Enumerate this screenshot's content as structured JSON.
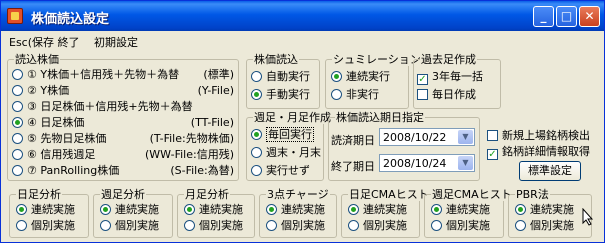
{
  "window": {
    "title": "株価読込設定"
  },
  "titlebar_buttons": {
    "minimize": "_",
    "maximize": "□",
    "close": "✕"
  },
  "menu": [
    "Esc(保存 終了",
    "初期設定"
  ],
  "stock_load": {
    "legend": "読込株価",
    "items": [
      {
        "left": "① Y株価＋信用残＋先物＋為替",
        "right": "(標準)",
        "selected": false
      },
      {
        "left": "② Y株価",
        "right": "(Y-File)",
        "selected": false
      },
      {
        "left": "③ 日足株価＋信用残+先物＋為替",
        "right": "",
        "selected": false
      },
      {
        "left": "④ 日足株価",
        "right": "(TT-File)",
        "selected": true
      },
      {
        "left": "⑤ 先物日足株価",
        "right": "(T-File:先物株価)",
        "selected": false
      },
      {
        "left": "⑥ 信用残週足",
        "right": "(WW-File:信用残)",
        "selected": false
      },
      {
        "left": "⑦ PanRolling株価",
        "right": "(S-File:為替)",
        "selected": false
      }
    ]
  },
  "price_read": {
    "legend": "株価読込",
    "options": [
      "自動実行",
      "手動実行"
    ],
    "selected": 1
  },
  "simulation": {
    "legend": "シュミレーション",
    "options": [
      "連続実行",
      "非実行"
    ],
    "selected": 0
  },
  "past_data": {
    "legend": "過去足作成",
    "options": [
      {
        "label": "3年毎一括",
        "checked": true
      },
      {
        "label": "毎日作成",
        "checked": false
      }
    ]
  },
  "weekly_monthly": {
    "legend": "週足・月足作成",
    "options": [
      "毎回実行",
      "週末・月末",
      "実行せず"
    ],
    "selected": 0
  },
  "period": {
    "legend": "株価読込期日指定",
    "read_label": "読済期日",
    "read_date": "2008/10/22",
    "end_label": "終了期日",
    "end_date": "2008/10/24"
  },
  "checkboxes": [
    {
      "label": "新規上場銘柄検出",
      "checked": false
    },
    {
      "label": "銘柄詳細情報取得",
      "checked": true
    }
  ],
  "standard_button": "標準設定",
  "analysis": [
    {
      "legend": "日足分析",
      "options": [
        "連続実施",
        "個別実施"
      ],
      "selected": 0
    },
    {
      "legend": "週足分析",
      "options": [
        "連続実施",
        "個別実施"
      ],
      "selected": 0
    },
    {
      "legend": "月足分析",
      "options": [
        "連続実施",
        "個別実施"
      ],
      "selected": 0
    },
    {
      "legend": "3点チャージ",
      "options": [
        "連続実施",
        "個別実施"
      ],
      "selected": 0
    },
    {
      "legend": "日足CMAヒスト",
      "options": [
        "連続実施",
        "個別実施"
      ],
      "selected": 0
    },
    {
      "legend": "週足CMAヒスト",
      "options": [
        "連続実施",
        "個別実施"
      ],
      "selected": 0
    },
    {
      "legend": "PBR法",
      "options": [
        "連続実施",
        "個別実施"
      ],
      "selected": 0
    }
  ]
}
